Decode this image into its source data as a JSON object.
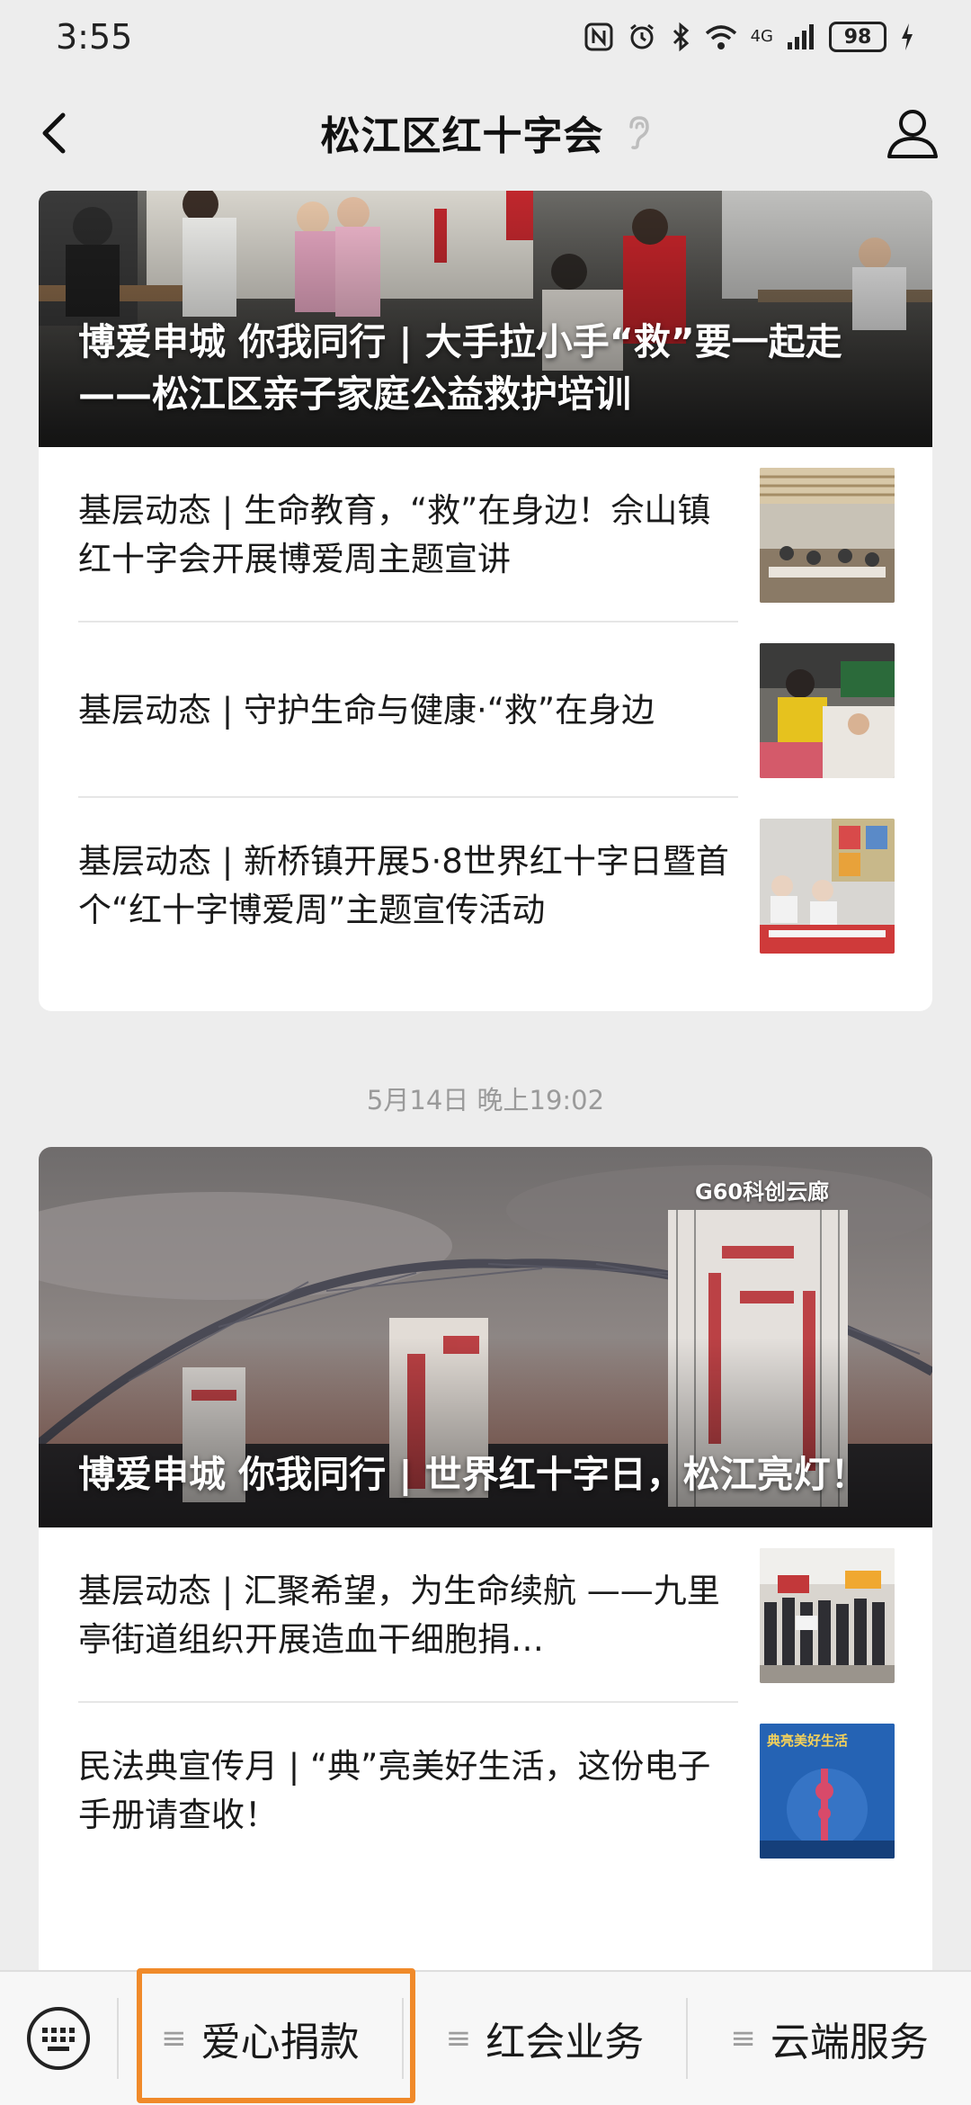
{
  "status_bar": {
    "time": "3:55",
    "network": "4G",
    "battery": "98",
    "icons": [
      "nfc-icon",
      "alarm-icon",
      "bluetooth-icon",
      "wifi-icon",
      "signal-icon",
      "battery-icon",
      "charging-icon"
    ]
  },
  "nav": {
    "title": "松江区红十字会",
    "back_icon": "chevron-left-icon",
    "listen_icon": "ear-icon",
    "profile_icon": "user-profile-icon"
  },
  "feed": {
    "groups": [
      {
        "cover_title": "博爱申城 你我同行 | 大手拉小手“救”要一起走——松江区亲子家庭公益救护培训",
        "items": [
          {
            "title": "基层动态 | 生命教育，“救”在身边！佘山镇红十字会开展博爱周主题宣讲"
          },
          {
            "title": "基层动态 | 守护生命与健康·“救”在身边"
          },
          {
            "title": "基层动态 | 新桥镇开展5·8世界红十字日暨首个“红十字博爱周”主题宣传活动"
          }
        ]
      },
      {
        "timestamp": "5月14日 晚上19:02",
        "cover_overlay_text": "G60科创云廊",
        "cover_title": "博爱申城 你我同行 | 世界红十字日，松江亮灯！",
        "items": [
          {
            "title": "基层动态 | 汇聚希望，为生命续航 ——九里亭街道组织开展造血干细胞捐…"
          },
          {
            "title": "民法典宣传月 | “典”亮美好生活，这份电子手册请查收！"
          }
        ],
        "thumb_text": "典亮美好生活"
      }
    ]
  },
  "bottom_menu": {
    "keyboard_icon": "keyboard-icon",
    "items": [
      {
        "label": "爱心捐款"
      },
      {
        "label": "红会业务"
      },
      {
        "label": "云端服务"
      }
    ],
    "highlight_color": "#f08a2a"
  }
}
